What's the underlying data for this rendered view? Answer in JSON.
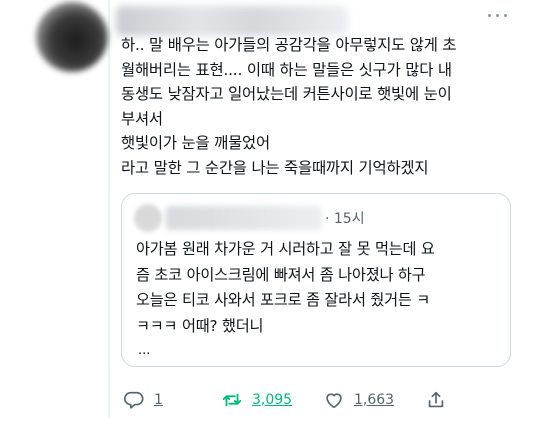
{
  "tweet": {
    "text": "하.. 말 배우는 아가들의 공감각을 아무렇지도 않게 초\n월해버리는 표현.... 이때 하는 말들은 싯구가 많다 내\n동생도 낮잠자고 일어났는데 커튼사이로 햇빛에 눈이\n부셔서\n햇빛이가 눈을 깨물었어\n라고 말한 그 순간을 나는 죽을때까지 기억하겠지",
    "more_icon": "more-horizontal-icon"
  },
  "quote": {
    "time": "· 15시",
    "text": "아가봄 원래 차가운 거 시러하고 잘 못 먹는데 요\n즘 초코 아이스크림에 빠져서 좀 나아졌나 하구\n오늘은 티코 사와서 포크로 좀 잘라서 줬거든 ㅋ\nㅋㅋㅋ 어때? 했더니",
    "ellipsis": "..."
  },
  "actions": {
    "reply_count": "1",
    "retweet_count": "3,095",
    "like_count": "1,663",
    "reply_icon": "reply-icon",
    "retweet_icon": "retweet-icon",
    "like_icon": "heart-icon",
    "share_icon": "share-icon"
  },
  "colors": {
    "text": "#0f1419",
    "muted": "#536471",
    "retweet_green": "#00ba7c",
    "border": "#cfd9de"
  }
}
